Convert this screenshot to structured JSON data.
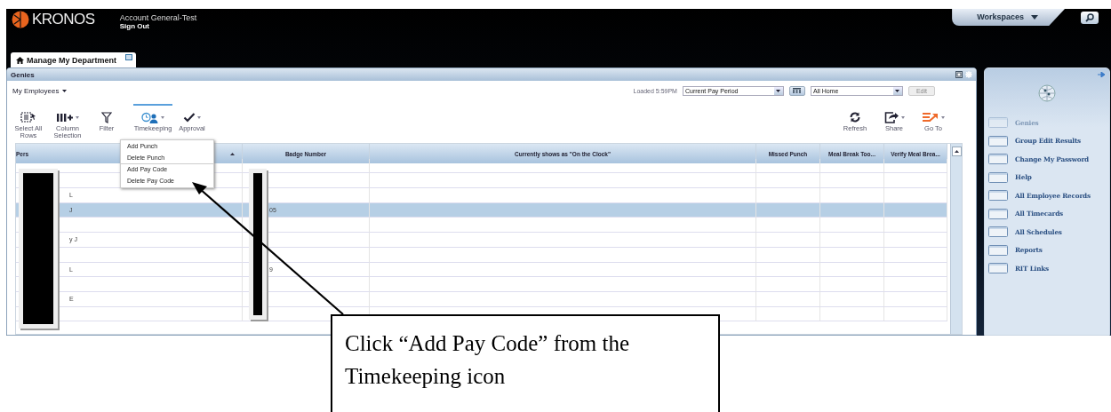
{
  "header": {
    "logo": "KRONOS",
    "account": "Account General-Test",
    "sign_out": "Sign Out",
    "workspaces": "Workspaces"
  },
  "tabs": [
    {
      "label": "Manage My Department",
      "selected": true
    }
  ],
  "panel": {
    "title": "Genies",
    "view_selector": "My Employees",
    "loaded": "Loaded 5:59PM",
    "period": "Current Pay Period",
    "location": "All Home",
    "edit": {
      "label": "Edit",
      "disabled": true
    }
  },
  "toolbar_left": [
    {
      "kind": "select-all",
      "label": "Select All Rows",
      "dropdown": false,
      "selected": false
    },
    {
      "kind": "columns",
      "label": "Column Selection",
      "dropdown": true,
      "selected": false
    },
    {
      "kind": "filter",
      "label": "Filter",
      "dropdown": false,
      "selected": false
    },
    {
      "kind": "timekeeping",
      "label": "Timekeeping",
      "dropdown": true,
      "selected": true
    },
    {
      "kind": "approval",
      "label": "Approval",
      "dropdown": true,
      "selected": false
    }
  ],
  "toolbar_right": [
    {
      "kind": "refresh",
      "label": "Refresh",
      "dropdown": false
    },
    {
      "kind": "share",
      "label": "Share",
      "dropdown": true
    },
    {
      "kind": "goto",
      "label": "Go To",
      "dropdown": true
    }
  ],
  "menu": {
    "sections": [
      [
        "Add Punch",
        "Delete Punch"
      ],
      [
        "Add Pay Code",
        "Delete Pay Code"
      ]
    ]
  },
  "table": {
    "columns": [
      "Pers",
      "Badge Number",
      "Currently shows as \"On the Clock\"",
      "Missed Punch",
      "Meal Break Too...",
      "Verify Meal Brea..."
    ],
    "rows": [
      {
        "name": "",
        "badge": "",
        "selected": false
      },
      {
        "name": "",
        "badge": "",
        "selected": false
      },
      {
        "name": "L",
        "badge": "",
        "selected": false
      },
      {
        "name": "J",
        "badge": "05",
        "selected": true
      },
      {
        "name": "",
        "badge": "",
        "selected": false
      },
      {
        "name": "y J",
        "badge": "",
        "selected": false
      },
      {
        "name": "",
        "badge": "",
        "selected": false
      },
      {
        "name": "L",
        "badge": "9",
        "selected": false
      },
      {
        "name": "",
        "badge": "",
        "selected": false
      },
      {
        "name": "E",
        "badge": "",
        "selected": false
      },
      {
        "name": "",
        "badge": "",
        "selected": false
      }
    ]
  },
  "sidebar": {
    "items": [
      {
        "label": "Genies",
        "disabled": true
      },
      {
        "label": "Group Edit Results",
        "disabled": false
      },
      {
        "label": "Change My Password",
        "disabled": false
      },
      {
        "label": "Help",
        "disabled": false
      },
      {
        "label": "All Employee Records",
        "disabled": false
      },
      {
        "label": "All Timecards",
        "disabled": false
      },
      {
        "label": "All Schedules",
        "disabled": false
      },
      {
        "label": "Reports",
        "disabled": false
      },
      {
        "label": "RIT Links",
        "disabled": false
      }
    ]
  },
  "callout": {
    "text": "Click “Add Pay Code” from the Timekeeping icon"
  }
}
